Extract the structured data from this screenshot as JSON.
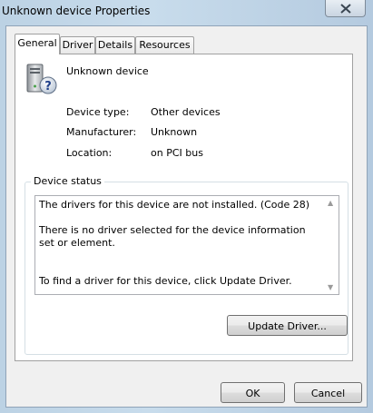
{
  "window": {
    "title": "Unknown device Properties",
    "close_icon": "close-icon"
  },
  "tabs": [
    {
      "label": "General",
      "active": true
    },
    {
      "label": "Driver",
      "active": false
    },
    {
      "label": "Details",
      "active": false
    },
    {
      "label": "Resources",
      "active": false
    }
  ],
  "device": {
    "icon": "unknown-device-icon",
    "name": "Unknown device",
    "properties": [
      {
        "label": "Device type:",
        "value": "Other devices"
      },
      {
        "label": "Manufacturer:",
        "value": "Unknown"
      },
      {
        "label": "Location:",
        "value": "on PCI bus"
      }
    ]
  },
  "device_status": {
    "legend": "Device status",
    "text": "The drivers for this device are not installed. (Code 28)\n\nThere is no driver selected for the device information set or element.\n\n\nTo find a driver for this device, click Update Driver.",
    "update_button": "Update Driver..."
  },
  "footer": {
    "ok_label": "OK",
    "cancel_label": "Cancel"
  }
}
